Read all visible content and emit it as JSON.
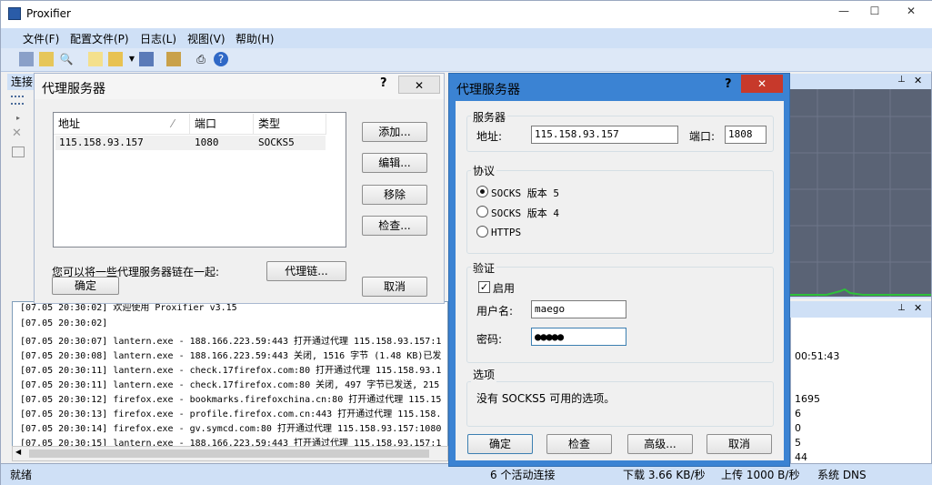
{
  "app": {
    "title": "Proxifier"
  },
  "menu": [
    "文件(F)",
    "配置文件(P)",
    "日志(L)",
    "视图(V)",
    "帮助(H)"
  ],
  "left_dock": {
    "title": "连接"
  },
  "log": {
    "lines": [
      "[07.05 20:30:02]      欢迎使用 Proxifier v3.15",
      "[07.05 20:30:02]",
      "[07.05 20:30:07] lantern.exe - 188.166.223.59:443 打开通过代理 115.158.93.157:1",
      "[07.05 20:30:08] lantern.exe - 188.166.223.59:443 关闭, 1516 字节 (1.48 KB)已发",
      "[07.05 20:30:11] lantern.exe - check.17firefox.com:80 打开通过代理 115.158.93.1",
      "[07.05 20:30:11] lantern.exe - check.17firefox.com:80 关闭, 497 字节已发送, 215",
      "[07.05 20:30:12] firefox.exe - bookmarks.firefoxchina.cn:80 打开通过代理 115.15",
      "[07.05 20:30:13] firefox.exe - profile.firefox.com.cn:443 打开通过代理 115.158.",
      "[07.05 20:30:14] firefox.exe - gv.symcd.com:80 打开通过代理 115.158.93.157:1080",
      "[07.05 20:30:15] lantern.exe - 188.166.223.59:443 打开通过代理 115.158.93.157:1"
    ]
  },
  "stats": {
    "values": [
      "00:51:43",
      "1695",
      "6",
      "0",
      "5",
      "44"
    ]
  },
  "status": {
    "ready": "就绪",
    "active": "6 个活动连接",
    "down": "下载 3.66 KB/秒",
    "up": "上传 1000 B/秒",
    "dns": "系统 DNS"
  },
  "dialog1": {
    "title": "代理服务器",
    "help": "?",
    "columns": [
      "地址",
      "端口",
      "类型"
    ],
    "rows": [
      {
        "addr": "115.158.93.157",
        "port": "1080",
        "type": "SOCKS5"
      }
    ],
    "buttons": {
      "add": "添加...",
      "edit": "编辑...",
      "remove": "移除",
      "check": "检查..."
    },
    "chain_hint": "您可以将一些代理服务器链在一起:",
    "chain_button": "代理链...",
    "ok": "确定",
    "cancel": "取消"
  },
  "dialog2": {
    "title": "代理服务器",
    "help": "?",
    "server_group": "服务器",
    "addr_label": "地址:",
    "addr_value": "115.158.93.157",
    "port_label": "端口:",
    "port_value": "1808",
    "protocol_group": "协议",
    "protocols": [
      "SOCKS 版本 5",
      "SOCKS 版本 4",
      "HTTPS"
    ],
    "selected_protocol": "SOCKS 版本 5",
    "auth_group": "验证",
    "enable_label": "启用",
    "enable_checked": true,
    "user_label": "用户名:",
    "user_value": "maego",
    "pass_label": "密码:",
    "pass_value": "●●●●●",
    "options_group": "选项",
    "options_text": "没有 SOCKS5 可用的选项。",
    "ok": "确定",
    "check": "检查",
    "advanced": "高级...",
    "cancel": "取消"
  },
  "colors": {
    "dialog_active_frame": "#3b83d3",
    "close_red": "#c7392b",
    "menubar": "#cfe0f6"
  }
}
